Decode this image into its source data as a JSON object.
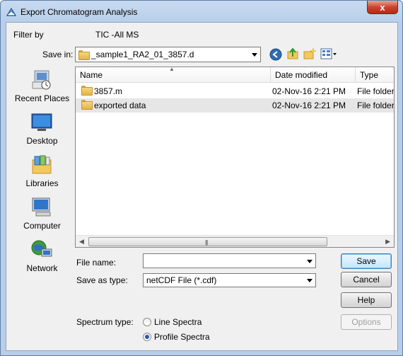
{
  "window": {
    "title": "Export Chromatogram Analysis",
    "close_glyph": "x"
  },
  "filter": {
    "label": "Filter by",
    "value": "TIC -All MS"
  },
  "save_in": {
    "label": "Save in:",
    "value": "_sample1_RA2_01_3857.d"
  },
  "places": [
    {
      "label": "Recent Places",
      "icon": "recent-places-icon"
    },
    {
      "label": "Desktop",
      "icon": "desktop-icon"
    },
    {
      "label": "Libraries",
      "icon": "libraries-icon"
    },
    {
      "label": "Computer",
      "icon": "computer-icon"
    },
    {
      "label": "Network",
      "icon": "network-icon"
    }
  ],
  "columns": {
    "name": "Name",
    "date": "Date modified",
    "type": "Type"
  },
  "files": [
    {
      "name": "3857.m",
      "date": "02-Nov-16 2:21 PM",
      "type": "File folder"
    },
    {
      "name": "exported data",
      "date": "02-Nov-16 2:21 PM",
      "type": "File folder"
    }
  ],
  "file_name": {
    "label": "File name:",
    "value": ""
  },
  "save_as_type": {
    "label": "Save as type:",
    "value": "netCDF File (*.cdf)"
  },
  "buttons": {
    "save": "Save",
    "cancel": "Cancel",
    "help": "Help",
    "options": "Options"
  },
  "spectrum": {
    "label": "Spectrum type:",
    "options": [
      "Line Spectra",
      "Profile Spectra"
    ],
    "selected": "Profile Spectra"
  },
  "colors": {
    "title_bar": "#b9cfe9",
    "close_button": "#c7452f",
    "selection": "#e6e6e6"
  }
}
